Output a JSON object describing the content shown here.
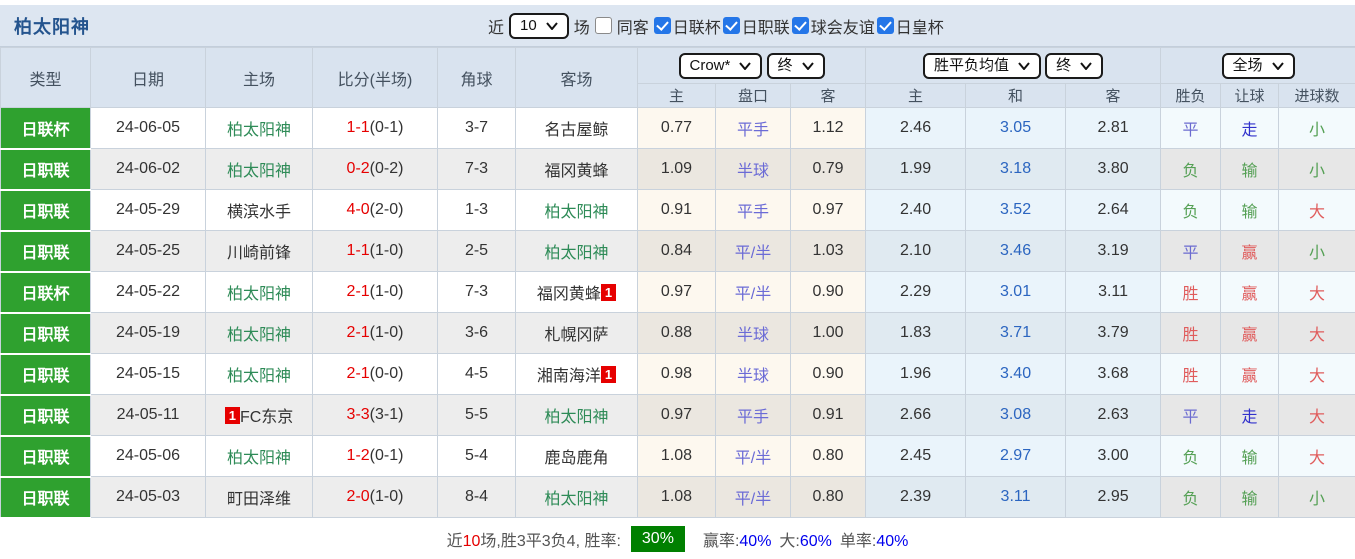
{
  "header": {
    "title": "柏太阳神",
    "near_label": "近",
    "near_value": "10",
    "games_label": "场",
    "same_away": {
      "label": "同客",
      "checked": false
    },
    "filters": [
      {
        "label": "日联杯",
        "checked": true
      },
      {
        "label": "日职联",
        "checked": true
      },
      {
        "label": "球会友谊",
        "checked": true
      },
      {
        "label": "日皇杯",
        "checked": true
      }
    ]
  },
  "table": {
    "columns": [
      "类型",
      "日期",
      "主场",
      "比分(半场)",
      "角球",
      "客场"
    ],
    "odds_group": {
      "select1": "Crow*",
      "select2": "终",
      "sub": [
        "主",
        "盘口",
        "客"
      ]
    },
    "mean_group": {
      "select1": "胜平负均值",
      "select2": "终",
      "sub": [
        "主",
        "和",
        "客"
      ]
    },
    "result_group": {
      "select": "全场",
      "sub": [
        "胜负",
        "让球",
        "进球数"
      ]
    },
    "rows": [
      {
        "type": "日联杯",
        "date": "24-06-05",
        "home": {
          "name": "柏太阳神",
          "self": true,
          "card": ""
        },
        "score": "1-1",
        "half": "(0-1)",
        "corners": "3-7",
        "away": {
          "name": "名古屋鲸",
          "self": false,
          "card": ""
        },
        "odds": [
          "0.77",
          "平手",
          "1.12"
        ],
        "mean": [
          "2.46",
          "3.05",
          "2.81"
        ],
        "results": [
          [
            "平",
            "blue"
          ],
          [
            "走",
            "blue2"
          ],
          [
            "小",
            "green"
          ]
        ]
      },
      {
        "type": "日职联",
        "date": "24-06-02",
        "home": {
          "name": "柏太阳神",
          "self": true,
          "card": ""
        },
        "score": "0-2",
        "half": "(0-2)",
        "corners": "7-3",
        "away": {
          "name": "福冈黄蜂",
          "self": false,
          "card": ""
        },
        "odds": [
          "1.09",
          "半球",
          "0.79"
        ],
        "mean": [
          "1.99",
          "3.18",
          "3.80"
        ],
        "results": [
          [
            "负",
            "green"
          ],
          [
            "输",
            "green"
          ],
          [
            "小",
            "green"
          ]
        ]
      },
      {
        "type": "日职联",
        "date": "24-05-29",
        "home": {
          "name": "横滨水手",
          "self": false,
          "card": ""
        },
        "score": "4-0",
        "half": "(2-0)",
        "corners": "1-3",
        "away": {
          "name": "柏太阳神",
          "self": true,
          "card": ""
        },
        "odds": [
          "0.91",
          "平手",
          "0.97"
        ],
        "mean": [
          "2.40",
          "3.52",
          "2.64"
        ],
        "results": [
          [
            "负",
            "green"
          ],
          [
            "输",
            "green"
          ],
          [
            "大",
            "red"
          ]
        ]
      },
      {
        "type": "日职联",
        "date": "24-05-25",
        "home": {
          "name": "川崎前锋",
          "self": false,
          "card": ""
        },
        "score": "1-1",
        "half": "(1-0)",
        "corners": "2-5",
        "away": {
          "name": "柏太阳神",
          "self": true,
          "card": ""
        },
        "odds": [
          "0.84",
          "平/半",
          "1.03"
        ],
        "mean": [
          "2.10",
          "3.46",
          "3.19"
        ],
        "results": [
          [
            "平",
            "blue"
          ],
          [
            "赢",
            "red"
          ],
          [
            "小",
            "green"
          ]
        ]
      },
      {
        "type": "日联杯",
        "date": "24-05-22",
        "home": {
          "name": "柏太阳神",
          "self": true,
          "card": ""
        },
        "score": "2-1",
        "half": "(1-0)",
        "corners": "7-3",
        "away": {
          "name": "福冈黄蜂",
          "self": false,
          "card": "1",
          "card_pos": "after"
        },
        "odds": [
          "0.97",
          "平/半",
          "0.90"
        ],
        "mean": [
          "2.29",
          "3.01",
          "3.11"
        ],
        "results": [
          [
            "胜",
            "red"
          ],
          [
            "赢",
            "red"
          ],
          [
            "大",
            "red"
          ]
        ]
      },
      {
        "type": "日职联",
        "date": "24-05-19",
        "home": {
          "name": "柏太阳神",
          "self": true,
          "card": ""
        },
        "score": "2-1",
        "half": "(1-0)",
        "corners": "3-6",
        "away": {
          "name": "札幌冈萨",
          "self": false,
          "card": ""
        },
        "odds": [
          "0.88",
          "半球",
          "1.00"
        ],
        "mean": [
          "1.83",
          "3.71",
          "3.79"
        ],
        "results": [
          [
            "胜",
            "red"
          ],
          [
            "赢",
            "red"
          ],
          [
            "大",
            "red"
          ]
        ]
      },
      {
        "type": "日职联",
        "date": "24-05-15",
        "home": {
          "name": "柏太阳神",
          "self": true,
          "card": ""
        },
        "score": "2-1",
        "half": "(0-0)",
        "corners": "4-5",
        "away": {
          "name": "湘南海洋",
          "self": false,
          "card": "1",
          "card_pos": "after"
        },
        "odds": [
          "0.98",
          "半球",
          "0.90"
        ],
        "mean": [
          "1.96",
          "3.40",
          "3.68"
        ],
        "results": [
          [
            "胜",
            "red"
          ],
          [
            "赢",
            "red"
          ],
          [
            "大",
            "red"
          ]
        ]
      },
      {
        "type": "日职联",
        "date": "24-05-11",
        "home": {
          "name": "FC东京",
          "self": false,
          "card": "1",
          "card_pos": "before"
        },
        "score": "3-3",
        "half": "(3-1)",
        "corners": "5-5",
        "away": {
          "name": "柏太阳神",
          "self": true,
          "card": ""
        },
        "odds": [
          "0.97",
          "平手",
          "0.91"
        ],
        "mean": [
          "2.66",
          "3.08",
          "2.63"
        ],
        "results": [
          [
            "平",
            "blue"
          ],
          [
            "走",
            "blue2"
          ],
          [
            "大",
            "red"
          ]
        ]
      },
      {
        "type": "日职联",
        "date": "24-05-06",
        "home": {
          "name": "柏太阳神",
          "self": true,
          "card": ""
        },
        "score": "1-2",
        "half": "(0-1)",
        "corners": "5-4",
        "away": {
          "name": "鹿岛鹿角",
          "self": false,
          "card": ""
        },
        "odds": [
          "1.08",
          "平/半",
          "0.80"
        ],
        "mean": [
          "2.45",
          "2.97",
          "3.00"
        ],
        "results": [
          [
            "负",
            "green"
          ],
          [
            "输",
            "green"
          ],
          [
            "大",
            "red"
          ]
        ]
      },
      {
        "type": "日职联",
        "date": "24-05-03",
        "home": {
          "name": "町田泽维",
          "self": false,
          "card": ""
        },
        "score": "2-0",
        "half": "(1-0)",
        "corners": "8-4",
        "away": {
          "name": "柏太阳神",
          "self": true,
          "card": ""
        },
        "odds": [
          "1.08",
          "平/半",
          "0.80"
        ],
        "mean": [
          "2.39",
          "3.11",
          "2.95"
        ],
        "results": [
          [
            "负",
            "green"
          ],
          [
            "输",
            "green"
          ],
          [
            "小",
            "green"
          ]
        ]
      }
    ]
  },
  "footer": {
    "prefix_near": "近",
    "prefix_count": "10",
    "prefix_rest": "场,胜3平3负4, 胜率:",
    "win_rate": "30%",
    "stats": [
      {
        "label": "赢率:",
        "value": "40%"
      },
      {
        "label": "大:",
        "value": "60%"
      },
      {
        "label": "单率:",
        "value": "40%"
      }
    ]
  },
  "colors": {
    "badge_green": "#2fa12f",
    "win_rate_bg": "#008000",
    "score_red": "#e60000",
    "team_green": "#2e8b57",
    "handicap_purple": "#6b6bd6",
    "draw_mean_blue": "#2b65c0",
    "stat_blue": "#0000ee",
    "checkbox_blue": "#2476e8"
  }
}
